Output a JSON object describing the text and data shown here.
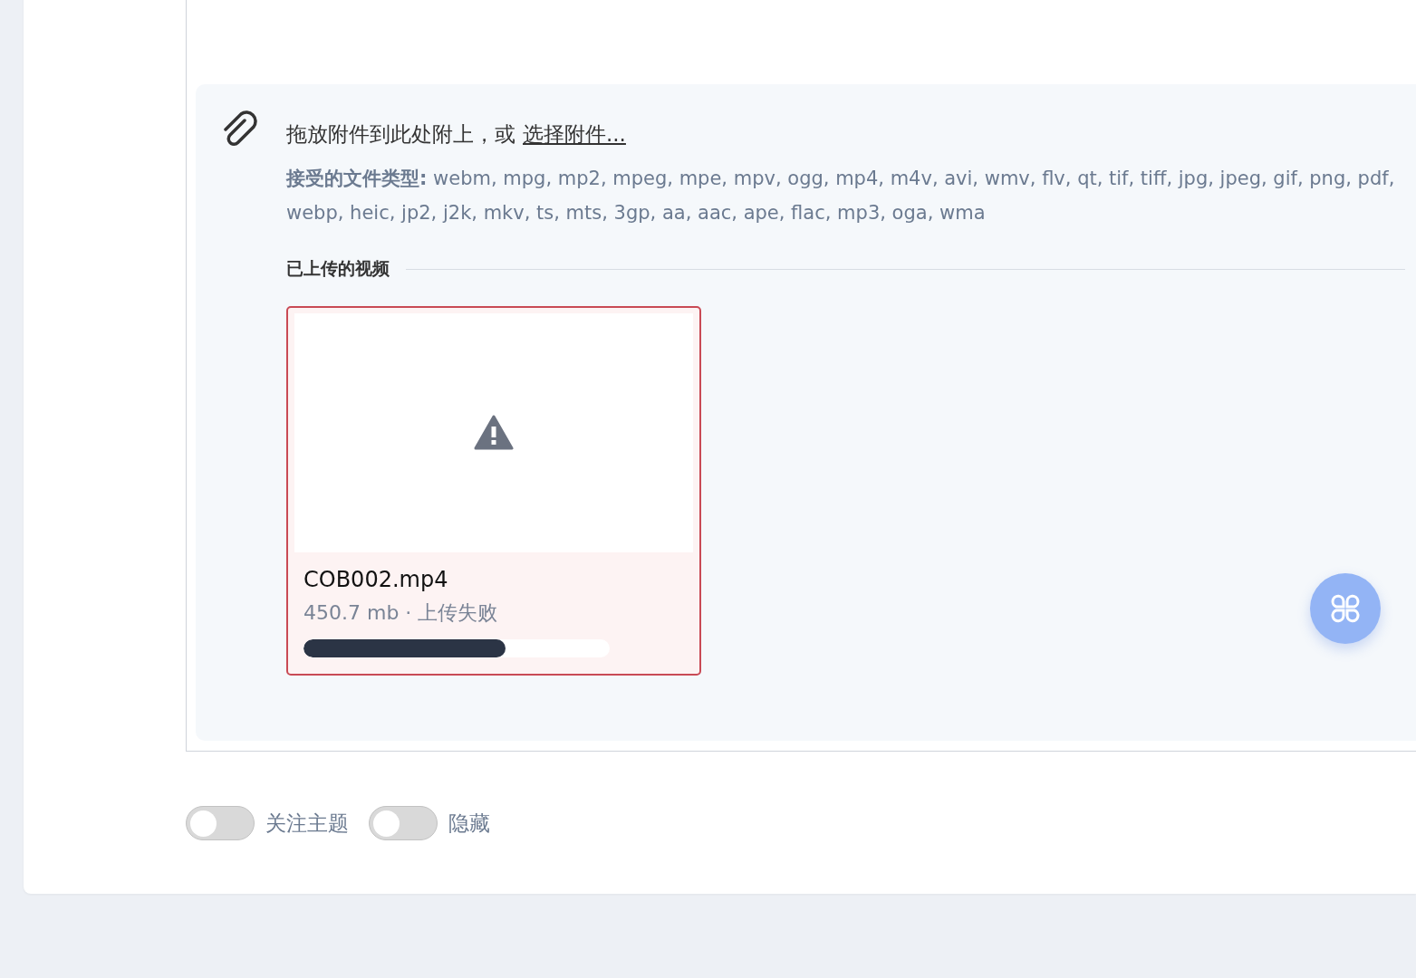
{
  "dropzone": {
    "prompt": "拖放附件到此处附上，或",
    "link": "选择附件...",
    "accepted": "**接受的文件类型:** webm, mpg, mp2, mpeg, mpe, mpv, ogg, mp4, m4v, avi, wmv, flv, qt, tif, tiff, jpg, jpeg, gif, png, pdf, webp, heic, jp2, j2k, mkv, ts, mts, 3gp, aa, aac, ape, flac, mp3, oga, wma"
  },
  "uploaded": {
    "heading": "已上传的视频",
    "files": [
      {
        "name": "COB002.mp4",
        "meta": "450.7 mb · 上传失败",
        "failed": true,
        "level": 0.66
      }
    ]
  },
  "toggles": [
    {
      "label": "关注主题",
      "on": false
    },
    {
      "label": "隐藏",
      "on": false
    }
  ]
}
